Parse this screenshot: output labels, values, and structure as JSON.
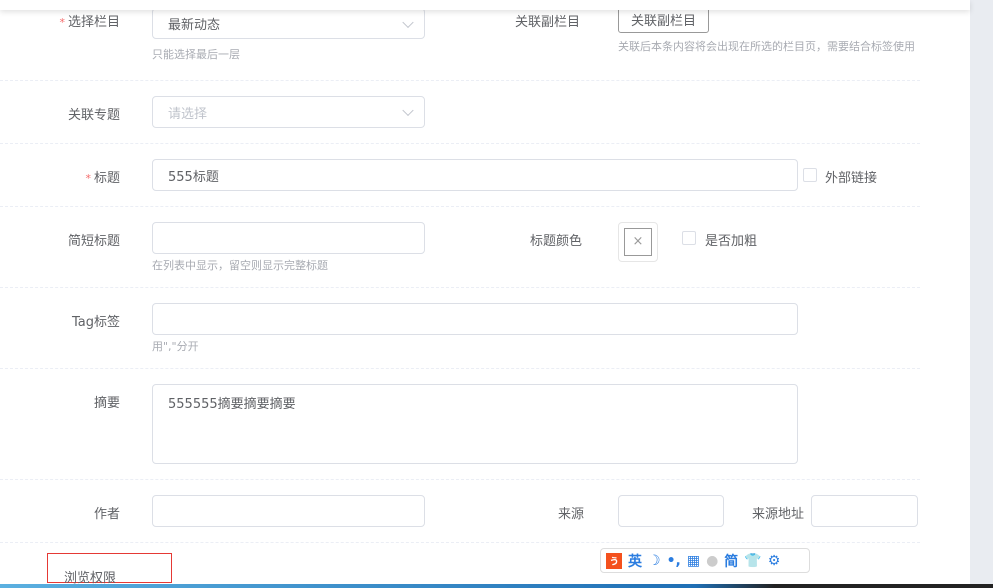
{
  "form": {
    "column": {
      "label": "选择栏目",
      "value": "最新动态",
      "hint": "只能选择最后一层"
    },
    "sub_column": {
      "label": "关联副栏目",
      "button": "关联副栏目",
      "hint": "关联后本条内容将会出现在所选的栏目页，需要结合标签使用"
    },
    "topic": {
      "label": "关联专题",
      "placeholder": "请选择"
    },
    "title": {
      "label": "标题",
      "value": "555标题",
      "external_link": "外部链接"
    },
    "short_title": {
      "label": "简短标题",
      "value": "",
      "hint": "在列表中显示，留空则显示完整标题"
    },
    "title_color": {
      "label": "标题颜色",
      "bold": "是否加粗"
    },
    "tags": {
      "label": "Tag标签",
      "value": "",
      "hint": "用\",\"分开"
    },
    "summary": {
      "label": "摘要",
      "value": "555555摘要摘要摘要"
    },
    "author": {
      "label": "作者",
      "value": ""
    },
    "source": {
      "label": "来源",
      "value": ""
    },
    "source_url": {
      "label": "来源地址",
      "value": ""
    },
    "view_permission": {
      "label": "浏览权限"
    }
  },
  "ime_toolbar": {
    "lang": "英",
    "simplified": "简"
  }
}
